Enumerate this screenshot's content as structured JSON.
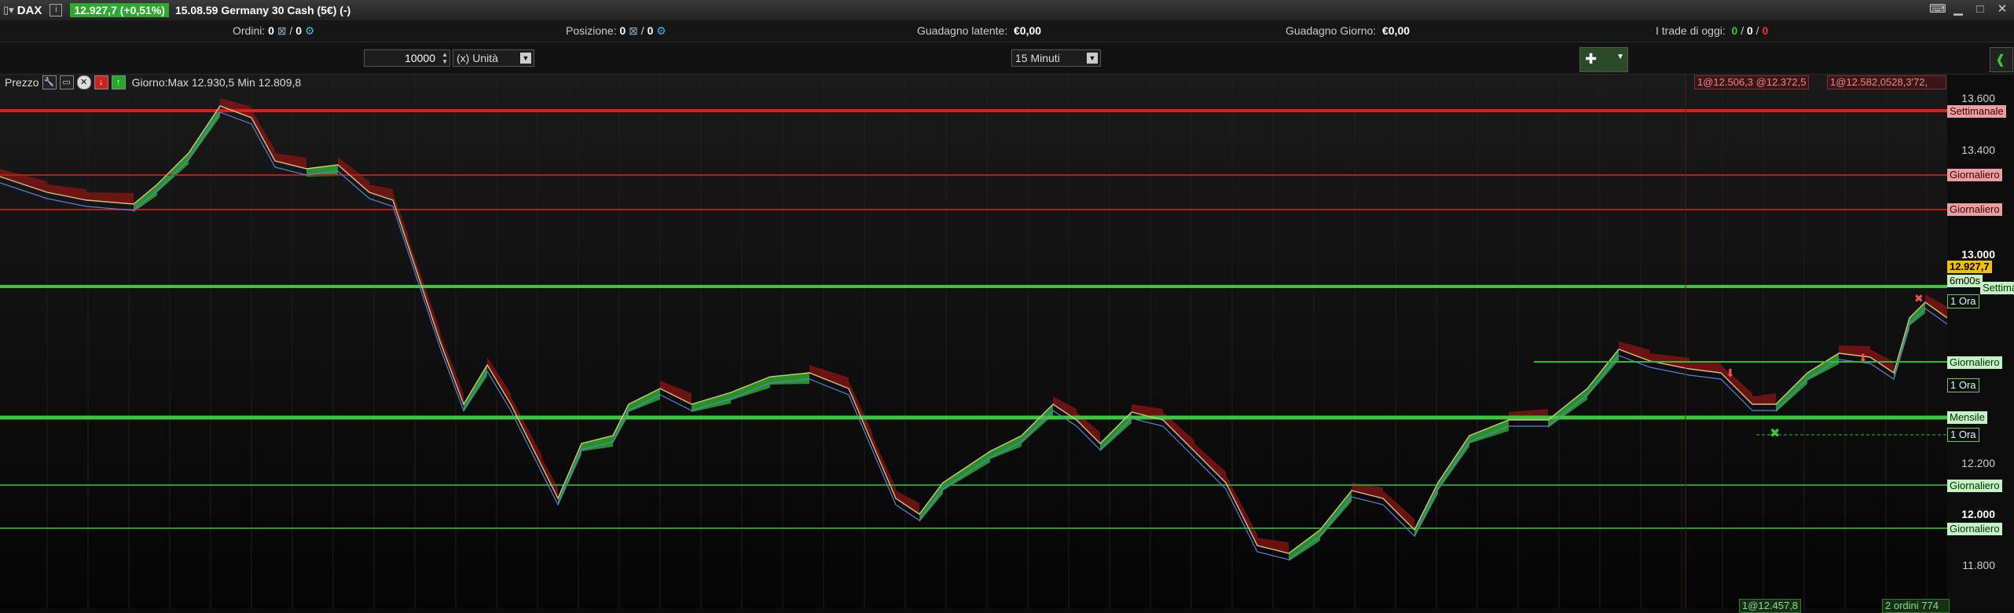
{
  "titlebar": {
    "symbol": "DAX",
    "price_badge": "12.927,7 (+0,51%)",
    "info": "15.08.59 Germany 30 Cash (5€) (-)"
  },
  "status": {
    "orders_label": "Ordini:",
    "orders_value": "0",
    "orders_value2": "0",
    "position_label": "Posizione:",
    "position_value": "0",
    "position_value2": "0",
    "latent_label": "Guadagno latente:",
    "latent_value": "€0,00",
    "day_label": "Guadagno Giorno:",
    "day_value": "€0,00",
    "trades_label": "I trade di oggi:",
    "trades_green": "0",
    "trades_sep1": "/",
    "trades_white": "0",
    "trades_sep2": "/",
    "trades_red": "0"
  },
  "order_bar": {
    "quantity": "10000",
    "unit": "(x) Unità",
    "timeframe": "15 Minuti"
  },
  "legend": {
    "label": "Prezzo",
    "day_range": "Giorno:Max 12.930,5 Min 12.809,8"
  },
  "price_axis": {
    "ticks": [
      "13.600",
      "13.400",
      "13.000",
      "12.200",
      "12.000",
      "11.800"
    ],
    "current_price": "12.927,7",
    "countdown": "6m00s"
  },
  "level_tags": {
    "settimanale_top": "Settimanale",
    "giornaliero_r1": "Giornaliero",
    "giornaliero_r2": "Giornaliero",
    "settimanale_green": "Settimanale",
    "ora_1": "1 Ora",
    "giornaliero_g1": "Giornaliero",
    "ora_2": "1 Ora",
    "mensile": "Mensile",
    "ora_3": "1 Ora",
    "giornaliero_g2": "Giornaliero",
    "giornaliero_g3": "Giornaliero"
  },
  "order_tags": {
    "top_a": "1@12.506,3 @12.372,5",
    "top_b": "1@12.582,0528,3'72,",
    "bottom_a": "1@12.457,8",
    "bottom_b": "2 ordini 774"
  },
  "colors": {
    "up": "#32c832",
    "down": "#c81e1e",
    "support": "#3cb43c",
    "resistance": "#d22020",
    "tag_red_bg": "#e8a0a0",
    "tag_green_bg": "#c6f0c6"
  }
}
